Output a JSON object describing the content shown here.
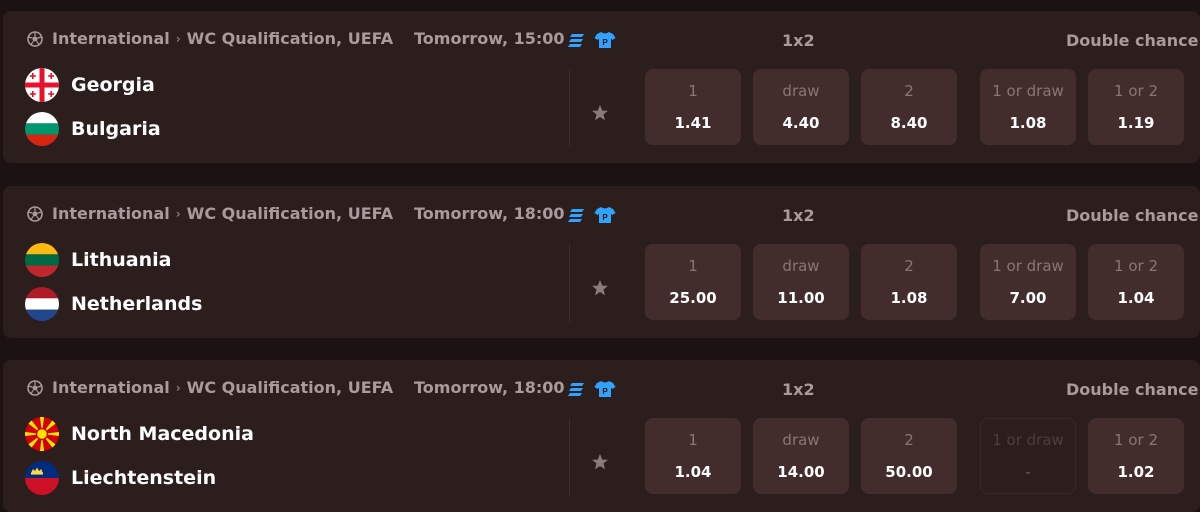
{
  "colors": {
    "page_background": "#1c1212",
    "card_background": "#2d1e1e",
    "odd_button_background": "#432c2c",
    "accent_blue": "#2fa3ff",
    "text_primary": "#ffffff",
    "text_muted": "#a99b9b"
  },
  "icons": {
    "sport": "soccer-ball-icon",
    "breadcrumb_separator": "chevron-right-icon",
    "stats": "statistics-icon",
    "lineup": "jersey-icon",
    "favorite": "star-icon"
  },
  "matches": [
    {
      "sport_label": "International",
      "separator": "›",
      "league": "WC Qualification, UEFA",
      "time": "Tomorrow, 15:00",
      "lineup_badge": "P",
      "market_1x2_title": "1x2",
      "market_dc_title": "Double chance",
      "home": {
        "name": "Georgia",
        "flag": "georgia-flag-icon"
      },
      "away": {
        "name": "Bulgaria",
        "flag": "bulgaria-flag-icon"
      },
      "odds": [
        {
          "label": "1",
          "value": "1.41",
          "disabled": false
        },
        {
          "label": "draw",
          "value": "4.40",
          "disabled": false
        },
        {
          "label": "2",
          "value": "8.40",
          "disabled": false
        },
        {
          "label": "1 or draw",
          "value": "1.08",
          "disabled": false
        },
        {
          "label": "1 or 2",
          "value": "1.19",
          "disabled": false
        }
      ]
    },
    {
      "sport_label": "International",
      "separator": "›",
      "league": "WC Qualification, UEFA",
      "time": "Tomorrow, 18:00",
      "lineup_badge": "P",
      "market_1x2_title": "1x2",
      "market_dc_title": "Double chance",
      "home": {
        "name": "Lithuania",
        "flag": "lithuania-flag-icon"
      },
      "away": {
        "name": "Netherlands",
        "flag": "netherlands-flag-icon"
      },
      "odds": [
        {
          "label": "1",
          "value": "25.00",
          "disabled": false
        },
        {
          "label": "draw",
          "value": "11.00",
          "disabled": false
        },
        {
          "label": "2",
          "value": "1.08",
          "disabled": false
        },
        {
          "label": "1 or draw",
          "value": "7.00",
          "disabled": false
        },
        {
          "label": "1 or 2",
          "value": "1.04",
          "disabled": false
        }
      ]
    },
    {
      "sport_label": "International",
      "separator": "›",
      "league": "WC Qualification, UEFA",
      "time": "Tomorrow, 18:00",
      "lineup_badge": "P",
      "market_1x2_title": "1x2",
      "market_dc_title": "Double chance",
      "home": {
        "name": "North Macedonia",
        "flag": "north-macedonia-flag-icon"
      },
      "away": {
        "name": "Liechtenstein",
        "flag": "liechtenstein-flag-icon"
      },
      "odds": [
        {
          "label": "1",
          "value": "1.04",
          "disabled": false
        },
        {
          "label": "draw",
          "value": "14.00",
          "disabled": false
        },
        {
          "label": "2",
          "value": "50.00",
          "disabled": false
        },
        {
          "label": "1 or draw",
          "value": "-",
          "disabled": true
        },
        {
          "label": "1 or 2",
          "value": "1.02",
          "disabled": false
        }
      ]
    }
  ]
}
